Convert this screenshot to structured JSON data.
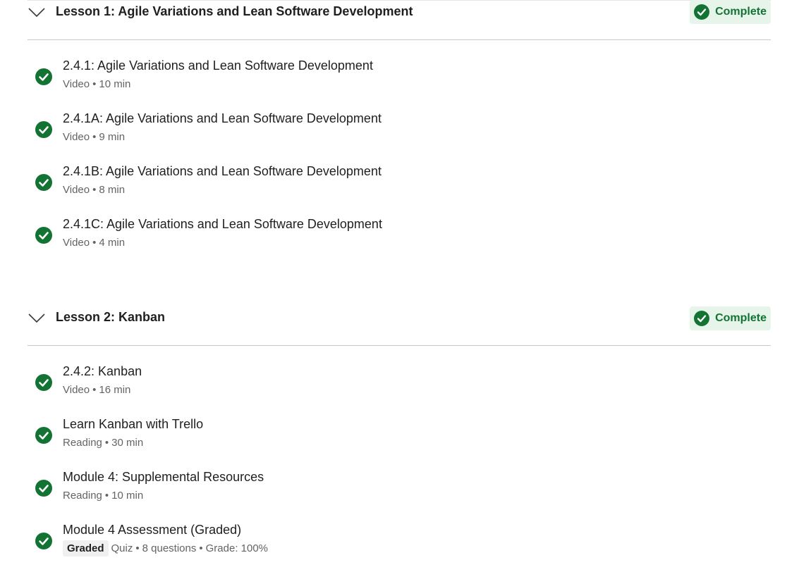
{
  "lessons": [
    {
      "title": "Lesson 1: Agile Variations and Lean Software Development",
      "status": "Complete",
      "items": [
        {
          "title": "2.4.1: Agile Variations and Lean Software Development",
          "type": "Video",
          "duration": "10 min"
        },
        {
          "title": "2.4.1A: Agile Variations and Lean Software Development",
          "type": "Video",
          "duration": "9 min"
        },
        {
          "title": "2.4.1B: Agile Variations and Lean Software Development",
          "type": "Video",
          "duration": "8 min"
        },
        {
          "title": "2.4.1C: Agile Variations and Lean Software Development",
          "type": "Video",
          "duration": "4 min"
        }
      ]
    },
    {
      "title": "Lesson 2: Kanban",
      "status": "Complete",
      "items": [
        {
          "title": "2.4.2: Kanban",
          "type": "Video",
          "duration": "16 min"
        },
        {
          "title": "Learn Kanban with Trello",
          "type": "Reading",
          "duration": "30 min"
        },
        {
          "title": "Module 4: Supplemental Resources",
          "type": "Reading",
          "duration": "10 min"
        },
        {
          "title": "Module 4 Assessment (Graded)",
          "badge": "Graded",
          "type": "Quiz",
          "questions": "8 questions",
          "grade": "Grade: 100%"
        }
      ]
    }
  ],
  "separator": "•",
  "icons": {
    "chevron": "chevron-down-icon",
    "check": "check-circle-icon"
  },
  "colors": {
    "success_green": "#137333",
    "badge_bg": "#e6f4ea",
    "divider": "#c8c8c8",
    "meta_text": "#636363"
  }
}
